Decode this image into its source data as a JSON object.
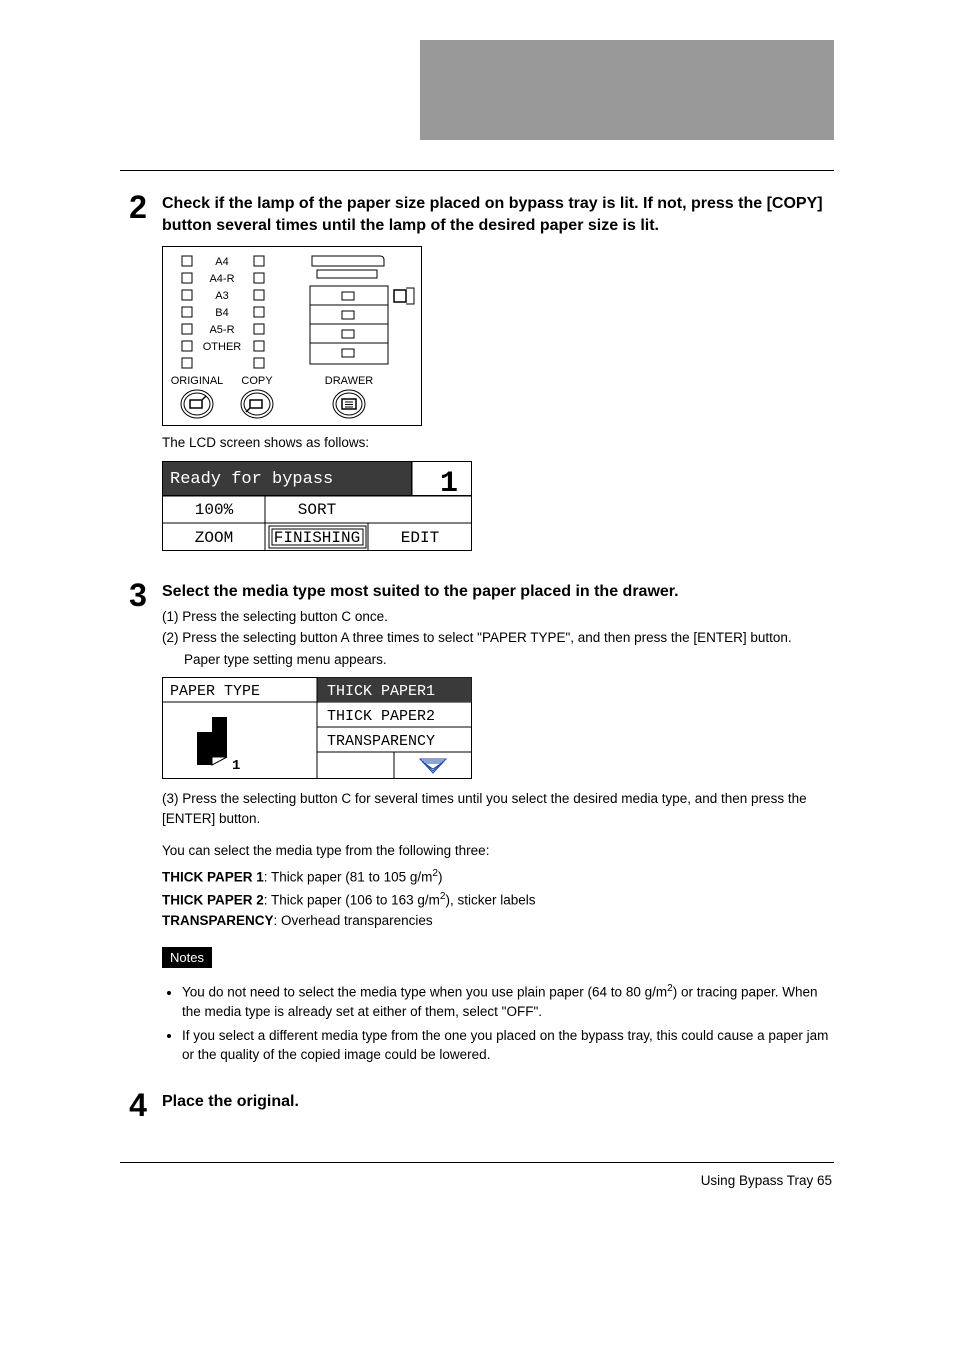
{
  "step2": {
    "num": "2",
    "heading": "Check if the lamp of the paper size placed on bypass tray is lit. If not, press the [COPY] button several times until the lamp of the desired paper size is lit.",
    "panel": {
      "sizes": [
        "A4",
        "A4-R",
        "A3",
        "B4",
        "A5-R",
        "OTHER"
      ],
      "labels": {
        "original": "ORIGINAL",
        "copy": "COPY",
        "drawer": "DRAWER"
      }
    },
    "lcd_intro": "The LCD screen shows as follows:",
    "lcd": {
      "line1": "Ready for bypass",
      "big1": "1",
      "percent": "100%",
      "sort": "SORT",
      "zoom": "ZOOM",
      "finishing": "FINISHING",
      "edit": "EDIT"
    }
  },
  "step3": {
    "num": "3",
    "heading": "Select the media type most suited to the paper placed in the drawer.",
    "sub1": "(1) Press the selecting button C once.",
    "sub2": "(2) Press the selecting button A three times to select \"PAPER TYPE\", and then press the [ENTER] button.",
    "sub2b": "Paper type setting menu appears.",
    "menu": {
      "title": "PAPER TYPE",
      "opt1": "THICK PAPER1",
      "opt2": "THICK PAPER2",
      "opt3": "TRANSPARENCY",
      "small1": "1"
    },
    "sub3": "(3) Press the selecting button C for several times until you select the desired media type, and then press the [ENTER] button.",
    "select_intro": "You can select the media type from the following three:",
    "tp1_label": "THICK PAPER 1",
    "tp1_rest": ": Thick paper (81 to 105 g/m",
    "tp1_sup": "2",
    "tp1_end": ")",
    "tp2_label": "THICK PAPER 2",
    "tp2_rest": ": Thick paper (106 to 163 g/m",
    "tp2_sup": "2",
    "tp2_end": "), sticker labels",
    "tr_label": "TRANSPARENCY",
    "tr_rest": ": Overhead transparencies",
    "notes_label": "Notes",
    "note1a": "You do not need to select the media type when you use plain paper (64 to 80 g/m",
    "note1_sup": "2",
    "note1b": ") or tracing paper. When the media type is already set at either of them, select \"OFF\".",
    "note2": "If you select a different media type from the one you placed on the bypass tray, this could cause a paper jam or the quality of the copied image could be lowered."
  },
  "step4": {
    "num": "4",
    "heading": "Place the original."
  },
  "footer": {
    "text": "Using Bypass Tray    65"
  }
}
